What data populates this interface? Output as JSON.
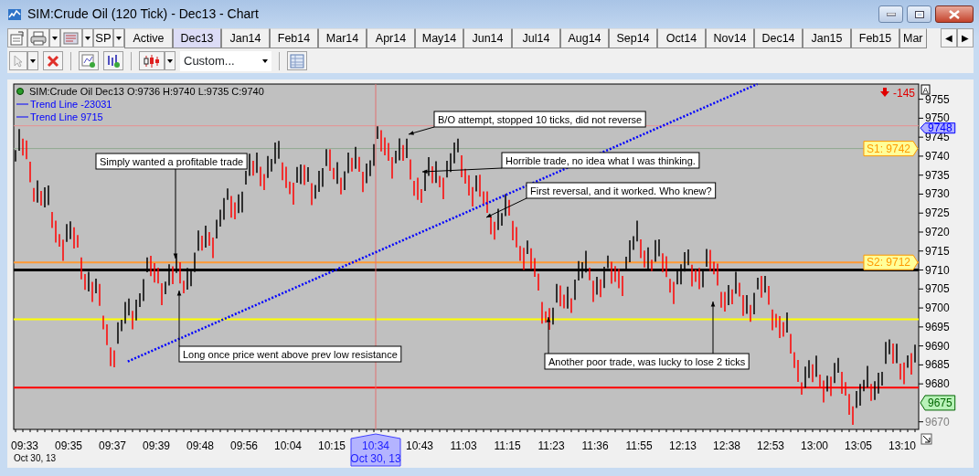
{
  "window": {
    "title": "SIM:Crude Oil (120 Tick) - Dec13 - Chart"
  },
  "toolbar": {
    "instrument": "SP",
    "chart_style": "Custom..."
  },
  "tabs": [
    {
      "label": "Active",
      "selected": false
    },
    {
      "label": "Dec13",
      "selected": true
    },
    {
      "label": "Jan14",
      "selected": false
    },
    {
      "label": "Feb14",
      "selected": false
    },
    {
      "label": "Mar14",
      "selected": false
    },
    {
      "label": "Apr14",
      "selected": false
    },
    {
      "label": "May14",
      "selected": false
    },
    {
      "label": "Jun14",
      "selected": false
    },
    {
      "label": "Jul14",
      "selected": false
    },
    {
      "label": "Aug14",
      "selected": false
    },
    {
      "label": "Sep14",
      "selected": false
    },
    {
      "label": "Oct14",
      "selected": false
    },
    {
      "label": "Nov14",
      "selected": false
    },
    {
      "label": "Dec14",
      "selected": false
    },
    {
      "label": "Jan15",
      "selected": false
    },
    {
      "label": "Feb15",
      "selected": false
    },
    {
      "label": "Mar",
      "selected": false
    }
  ],
  "tab_scroll": [
    "◀",
    "▶"
  ],
  "chart": {
    "legend": {
      "title": "SIM:Crude Oil Dec13 O:9736 H:9740 L:9735 C:9740",
      "lines": [
        "Trend Line -23031",
        "Trend Line 9715"
      ]
    },
    "pnl": "-145",
    "autoscale": "A",
    "y_axis_labels": [
      "9755",
      "9750",
      "9745",
      "9740",
      "9735",
      "9730",
      "9725",
      "9720",
      "9715",
      "9710",
      "9705",
      "9700",
      "9695",
      "9690",
      "9685",
      "9680",
      "9670"
    ],
    "x_axis_labels": [
      "09:33",
      "09:35",
      "09:37",
      "09:39",
      "09:48",
      "09:56",
      "10:04",
      "10:15",
      "10:43",
      "11:03",
      "11:15",
      "11:23",
      "11:36",
      "11:55",
      "12:13",
      "12:38",
      "12:53",
      "13:00",
      "13:05",
      "13:10"
    ],
    "date_label": "Oct 30, 13",
    "crosshair": {
      "time": "10:34",
      "date": "Oct 30, 13"
    },
    "axis_tags": [
      {
        "kind": "marker",
        "label": "9748"
      },
      {
        "kind": "support",
        "label": "S1: 9742"
      },
      {
        "kind": "support",
        "label": "S2: 9712"
      },
      {
        "kind": "last",
        "label": "9675"
      }
    ],
    "notes": [
      "B/O attempt, stopped 10 ticks, did not reverse",
      "Horrible trade, no idea what I was thinking.",
      "First reversal, and it worked. Who knew?",
      "Simply wanted a profitable trade",
      "Long once price went above prev low resistance",
      "Another poor trade, was lucky to lose 2 ticks"
    ]
  }
}
